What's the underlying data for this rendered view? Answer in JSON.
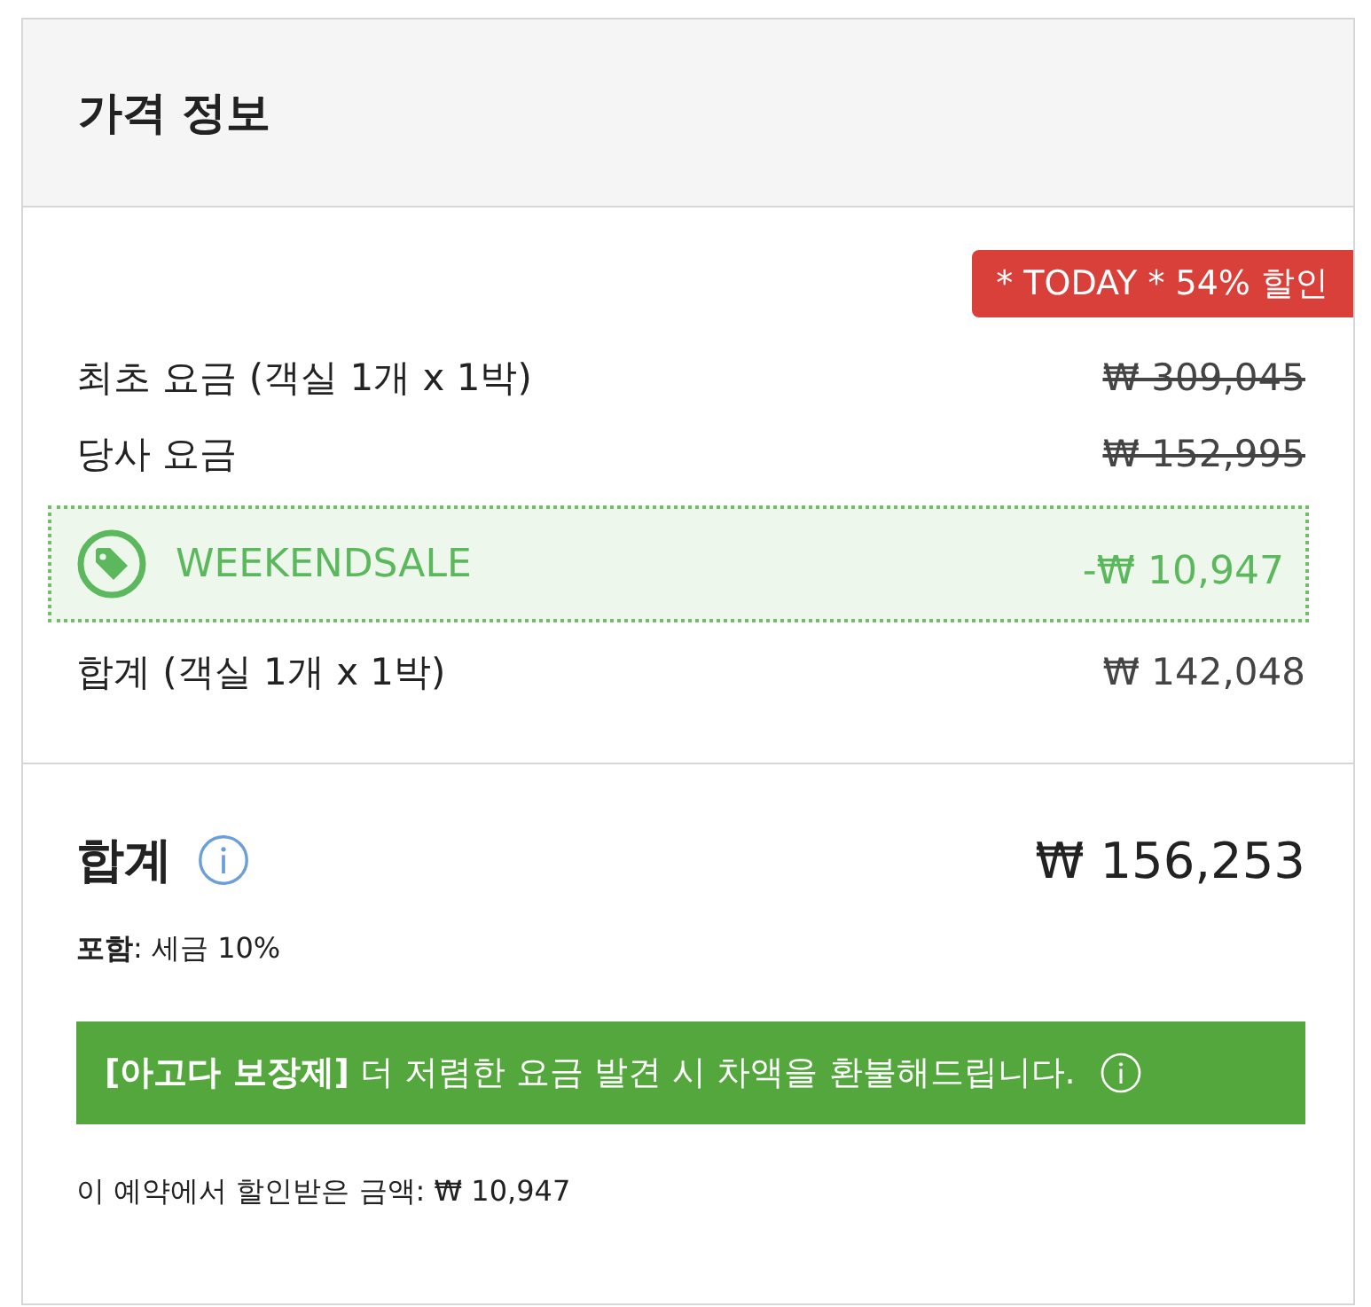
{
  "header": {
    "title": "가격 정보"
  },
  "badge": "* TODAY * 54% 할인",
  "rows": [
    {
      "kind": "struck",
      "label": "최초 요금 (객실 1개 x 1박)",
      "amount": "₩ 309,045"
    },
    {
      "kind": "struck",
      "label": "당사 요금",
      "amount": "₩ 152,995"
    },
    {
      "kind": "promo",
      "label": "WEEKENDSALE",
      "amount": "-₩ 10,947"
    },
    {
      "kind": "normal",
      "label": "합계 (객실 1개 x 1박)",
      "amount": "₩ 142,048"
    }
  ],
  "total": {
    "label": "합계",
    "amount": "₩ 156,253",
    "tax": "**포함**: 세금 10%"
  },
  "guarantee": "**[아고다 보장제]** 더 저렴한 요금 발견 시 차액을 환불해드립니다.",
  "savings": "이 예약에서 할인받은 금액: ₩ 10,947"
}
